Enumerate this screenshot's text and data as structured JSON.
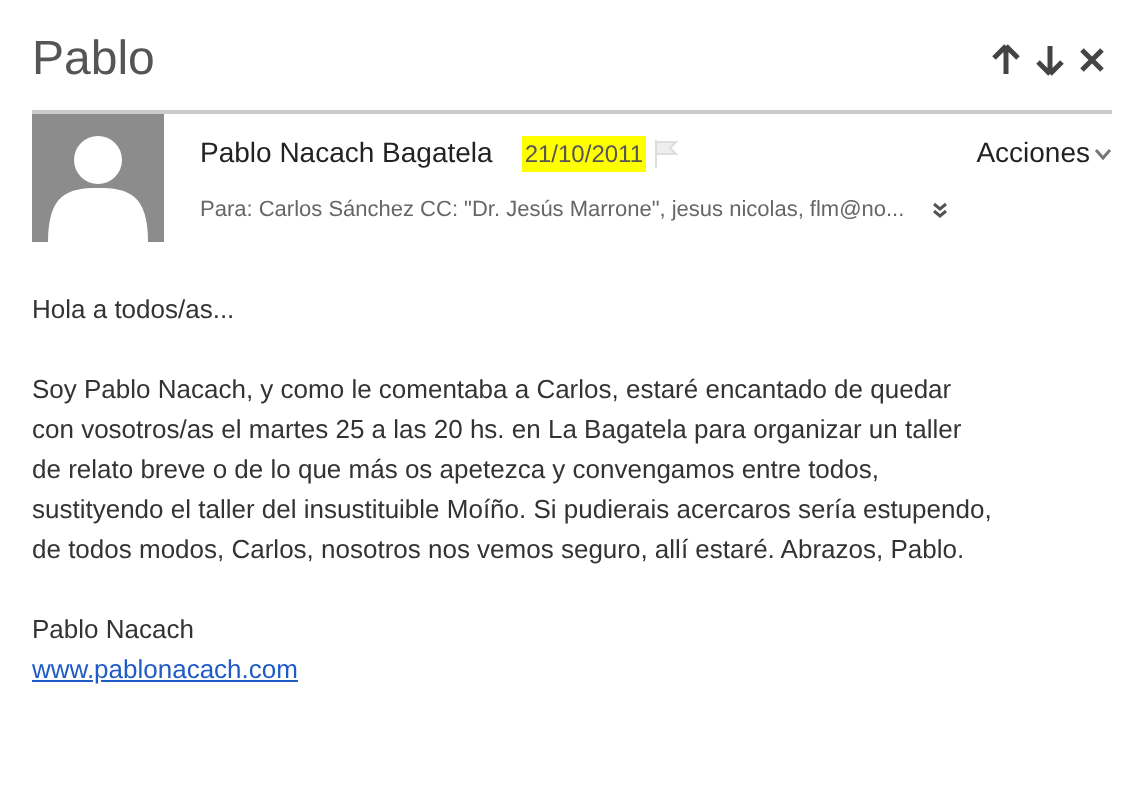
{
  "title": "Pablo",
  "message": {
    "sender": "Pablo Nacach Bagatela",
    "date": "21/10/2011",
    "flagged": false,
    "actions": "Acciones",
    "recipients": "Para: Carlos Sánchez CC: \"Dr. Jesús Marrone\", jesus nicolas, flm@no...",
    "greeting": "Hola a todos/as...",
    "body_lines": [
      "Soy Pablo Nacach, y como le comentaba a Carlos, estaré encantado de quedar",
      "con vosotros/as el martes 25 a las 20 hs. en La Bagatela para organizar un taller",
      "de relato breve o de lo que más os apetezca y convengamos entre todos,",
      "sustityendo el taller del insustituible Moíño. Si pudierais acercaros sería estupendo,",
      "de todos modos, Carlos, nosotros nos vemos seguro, allí estaré. Abrazos, Pablo."
    ],
    "signature": "Pablo Nacach",
    "link": "www.pablonacach.com"
  }
}
